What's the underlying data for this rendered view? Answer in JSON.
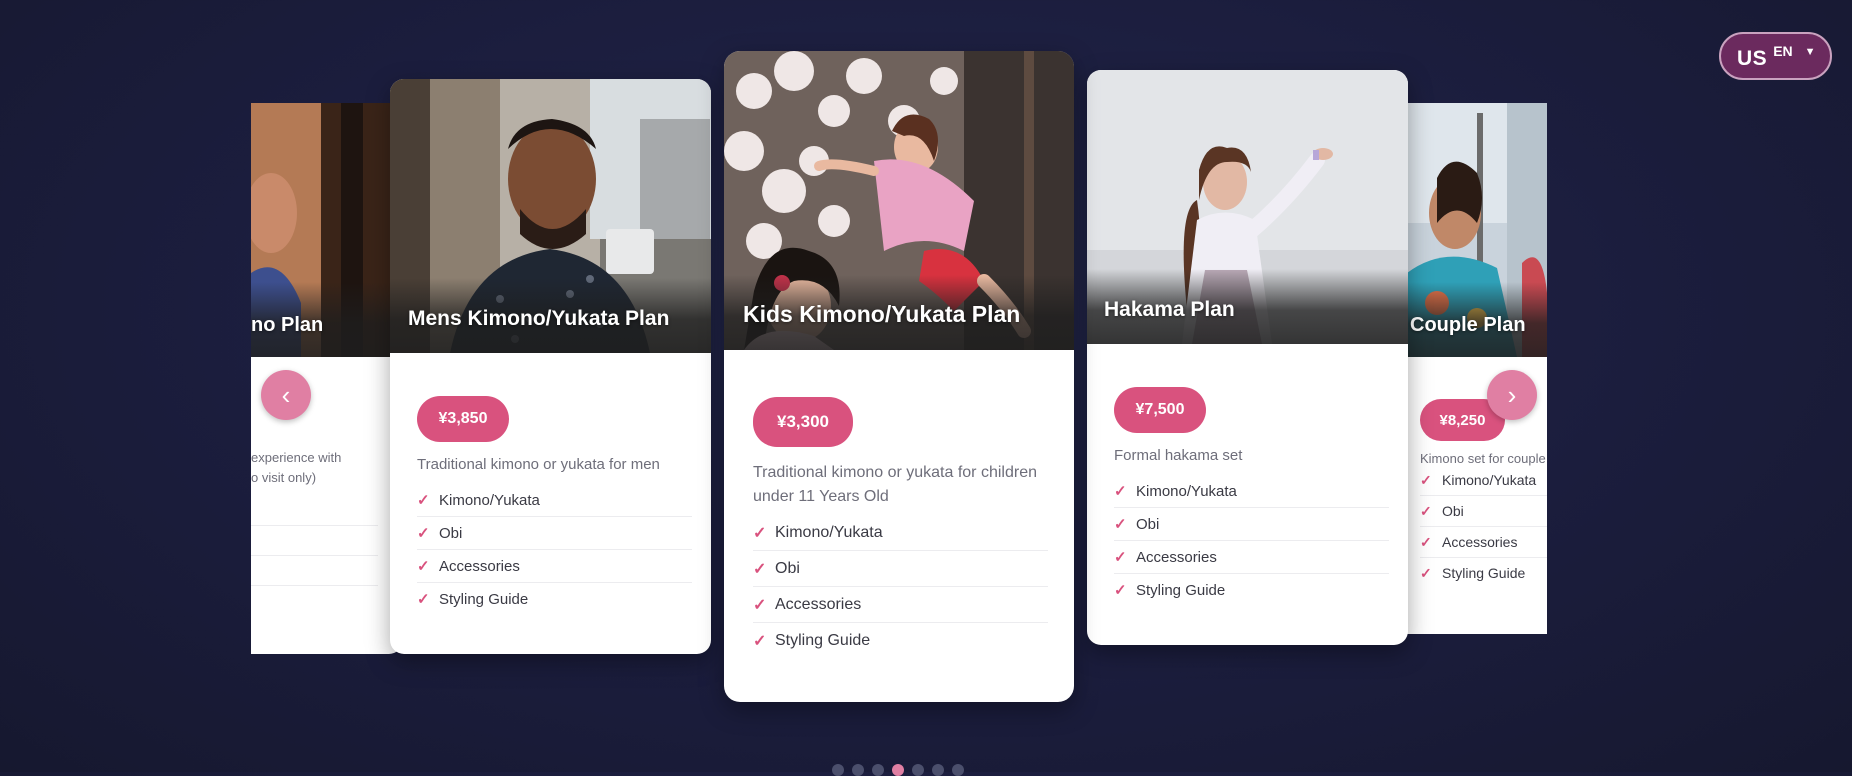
{
  "language": {
    "country": "US",
    "lang": "EN",
    "caret": "▼"
  },
  "nav": {
    "prev_icon": "‹",
    "next_icon": "›"
  },
  "cards": [
    {
      "title": "no Plan",
      "desc": "experience with\no visit only)"
    },
    {
      "title": "Mens Kimono/Yukata Plan",
      "price": "¥3,850",
      "desc": "Traditional kimono or yukata for men",
      "features": [
        "Kimono/Yukata",
        "Obi",
        "Accessories",
        "Styling Guide"
      ]
    },
    {
      "title": "Kids Kimono/Yukata Plan",
      "price": "¥3,300",
      "desc": "Traditional kimono or yukata for children under 11 Years Old",
      "features": [
        "Kimono/Yukata",
        "Obi",
        "Accessories",
        "Styling Guide"
      ]
    },
    {
      "title": "Hakama Plan",
      "price": "¥7,500",
      "desc": "Formal hakama set",
      "features": [
        "Kimono/Yukata",
        "Obi",
        "Accessories",
        "Styling Guide"
      ]
    },
    {
      "title": "Couple Plan",
      "price": "¥8,250",
      "desc": "Kimono set for couple",
      "features": [
        "Kimono/Yukata",
        "Obi",
        "Accessories",
        "Styling Guide"
      ]
    }
  ],
  "pagination": {
    "count": 7,
    "active_index": 3
  },
  "colors": {
    "accent": "#d9527e",
    "nav_button": "#e07fa3",
    "background": "#1b1d3d",
    "lang_bg": "#6b2a5e"
  },
  "icons": [
    "check-icon",
    "chevron-left-icon",
    "chevron-right-icon",
    "caret-down-icon"
  ]
}
